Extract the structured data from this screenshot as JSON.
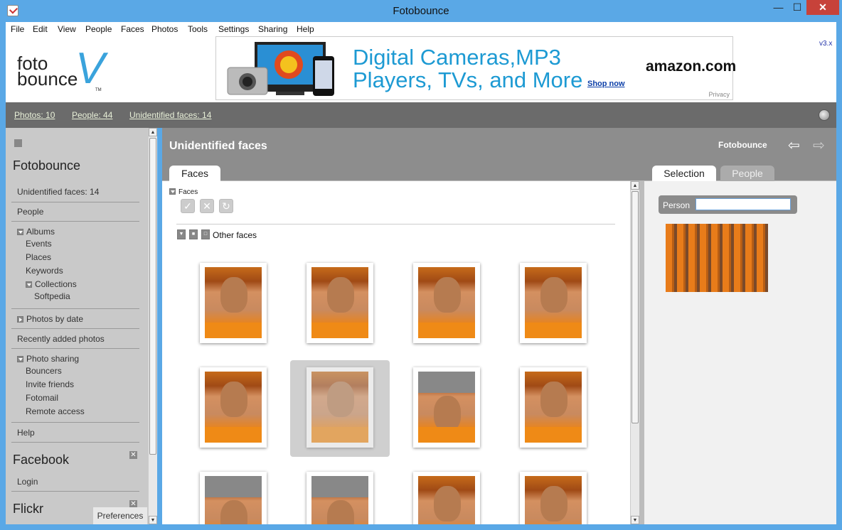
{
  "window": {
    "title": "Fotobounce",
    "min": "—",
    "max": "☐",
    "close": "✕"
  },
  "menu": [
    "File",
    "Edit",
    "View",
    "People",
    "Faces",
    "Photos",
    "Tools",
    "Settings",
    "Sharing",
    "Help"
  ],
  "logo": {
    "line1": "foto",
    "line2": "bounce",
    "tm": "TM"
  },
  "ad": {
    "headline_1": "Digital Cameras,MP3",
    "headline_2": "Players, TVs, and More",
    "shop": "Shop now",
    "brand": "amazon.com",
    "privacy": "Privacy"
  },
  "version": "v3.x",
  "nav": {
    "photos": "Photos: 10",
    "people": "People: 44",
    "unidentified": "Unidentified faces: 14"
  },
  "sidebar": {
    "section_title": "Fotobounce",
    "unidentified": "Unidentified faces: 14",
    "people": "People",
    "albums": "Albums",
    "events": "Events",
    "places": "Places",
    "keywords": "Keywords",
    "collections": "Collections",
    "softpedia": "Softpedia",
    "photos_by_date": "Photos by date",
    "recently_added": "Recently added photos",
    "photo_sharing": "Photo sharing",
    "bouncers": "Bouncers",
    "invite": "Invite friends",
    "fotomail": "Fotomail",
    "remote": "Remote access",
    "help": "Help",
    "facebook": "Facebook",
    "login": "Login",
    "flickr": "Flickr",
    "preferences": "Preferences"
  },
  "main": {
    "title": "Unidentified faces",
    "app": "Fotobounce",
    "tab_faces": "Faces",
    "faces_label": "Faces",
    "other_faces": "Other faces"
  },
  "selection": {
    "tab_selection": "Selection",
    "tab_people": "People",
    "person_label": "Person"
  }
}
